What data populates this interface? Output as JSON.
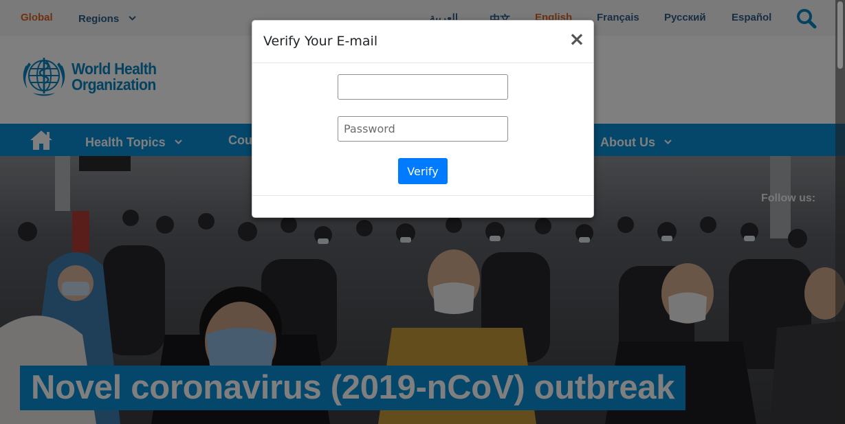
{
  "topbar": {
    "global_label": "Global",
    "regions_label": "Regions",
    "languages": [
      "العربية",
      "中文",
      "English",
      "Français",
      "Русский",
      "Español"
    ],
    "search_icon": "search-icon"
  },
  "logo": {
    "line1": "World Health",
    "line2": "Organization",
    "emblem_icon": "who-emblem-icon"
  },
  "nav": {
    "home_icon": "home-icon",
    "items": [
      "Health Topics",
      "Countries",
      "About Us"
    ]
  },
  "hero": {
    "follow_label": "Follow us:",
    "headline": "Novel coronavirus (2019-nCoV) outbreak"
  },
  "modal": {
    "title": "Verify Your E-mail",
    "close_symbol": "×",
    "email_value": "",
    "email_placeholder": "",
    "password_placeholder": "Password",
    "verify_label": "Verify"
  },
  "colors": {
    "nav_blue": "#0a8ed6",
    "logo_blue": "#0a84c1",
    "accent_orange": "#d86422",
    "link_blue": "#2e5c87",
    "button_blue": "#007bff"
  }
}
